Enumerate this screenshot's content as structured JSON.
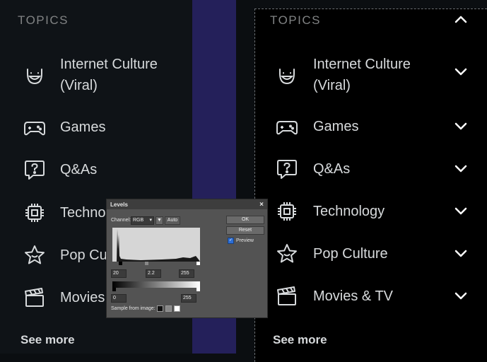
{
  "left_panel": {
    "heading": "TOPICS",
    "items": [
      {
        "label_line1": "Internet Culture",
        "label_line2": "(Viral)",
        "icon": "smile-icon"
      },
      {
        "label": "Games",
        "icon": "gamepad-icon"
      },
      {
        "label": "Q&As",
        "icon": "question-bubble-icon"
      },
      {
        "label": "Techno",
        "icon": "chip-icon"
      },
      {
        "label": "Pop Cu",
        "icon": "star-icon"
      },
      {
        "label": "Movies",
        "icon": "clapperboard-icon"
      }
    ],
    "see_more": "See more"
  },
  "right_panel": {
    "heading": "TOPICS",
    "items": [
      {
        "label_line1": "Internet Culture",
        "label_line2": "(Viral)",
        "icon": "smile-icon"
      },
      {
        "label": "Games",
        "icon": "gamepad-icon"
      },
      {
        "label": "Q&As",
        "icon": "question-bubble-icon"
      },
      {
        "label": "Technology",
        "icon": "chip-icon"
      },
      {
        "label": "Pop Culture",
        "icon": "star-icon"
      },
      {
        "label": "Movies & TV",
        "icon": "clapperboard-icon"
      }
    ],
    "see_more": "See more"
  },
  "levels_dialog": {
    "title": "Levels",
    "close": "×",
    "channel_label": "Channel:",
    "channel_value": "RGB",
    "auto_label": "Auto",
    "ok_label": "OK",
    "reset_label": "Reset",
    "preview_label": "Preview",
    "input_black": "20",
    "input_gamma": "2.2",
    "input_white": "255",
    "output_black": "0",
    "output_white": "255",
    "sample_label": "Sample from image:"
  },
  "colors": {
    "left_bg": "#0f1317",
    "right_bg": "#000000",
    "strip": "#24205a",
    "text": "#d7dadc",
    "muted": "#818384"
  }
}
